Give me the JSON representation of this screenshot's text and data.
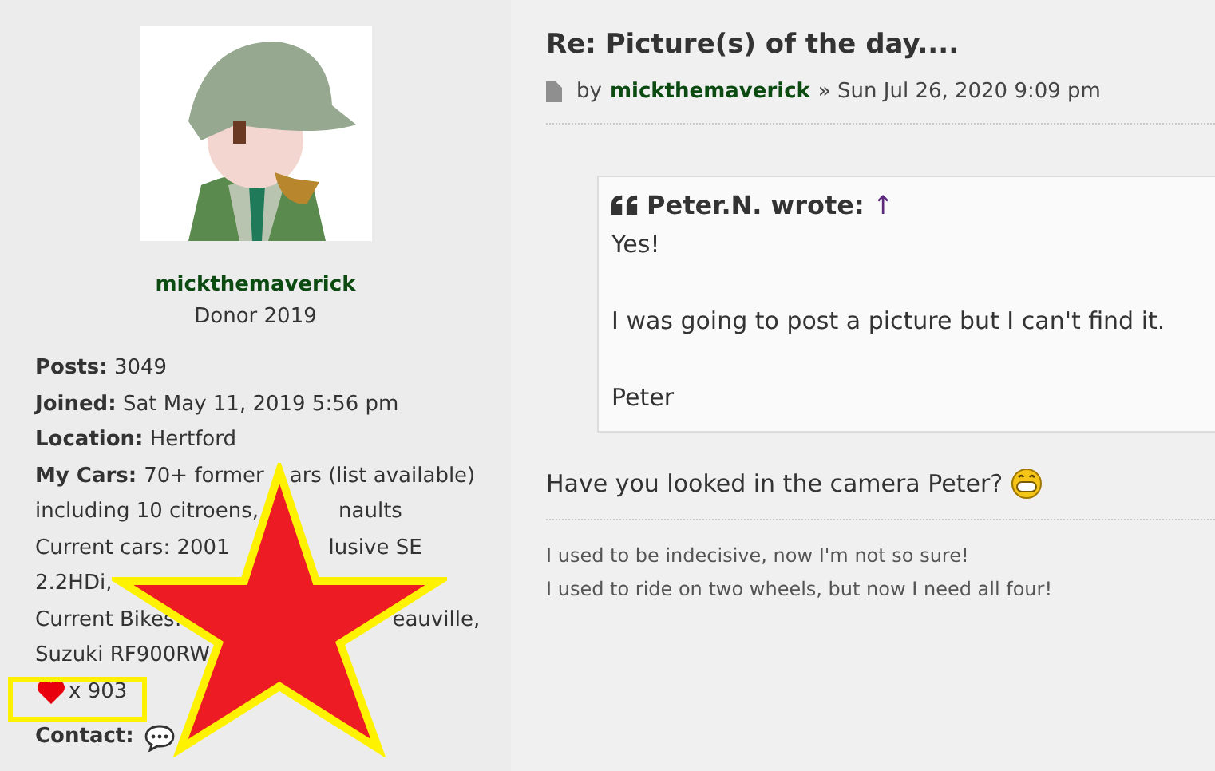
{
  "profile": {
    "username": "mickthemaverick",
    "rank": "Donor 2019",
    "lines": [
      {
        "kind": "field",
        "label": "Posts:",
        "value": "3049"
      },
      {
        "kind": "field",
        "label": "Joined:",
        "value": "Sat May 11, 2019 5:56 pm"
      },
      {
        "kind": "field",
        "label": "Location:",
        "value": "Hertford"
      },
      {
        "kind": "split",
        "label": "My Cars:",
        "left": "70+ former",
        "right": "ars (list available)"
      },
      {
        "kind": "split",
        "left": "including 10 citroens,",
        "right": "naults"
      },
      {
        "kind": "split",
        "left": "Current cars: 2001",
        "right": "lusive SE"
      },
      {
        "kind": "text",
        "value": "2.2HDi,"
      },
      {
        "kind": "split",
        "left": "Current Bikes:",
        "right": "eauville,"
      },
      {
        "kind": "text",
        "value": "Suzuki RF900RW"
      },
      {
        "kind": "likes",
        "value": "x 903"
      },
      {
        "kind": "contact",
        "label": "Contact:"
      }
    ]
  },
  "post": {
    "title": "Re: Picture(s) of the day....",
    "by": "by",
    "author": "mickthemaverick",
    "separator": "»",
    "date": "Sun Jul 26, 2020 9:09 pm",
    "quote": {
      "author": "Peter.N. wrote:",
      "link": "↑",
      "paragraphs": [
        "Yes!",
        "I was going to post a picture but I can't find it.",
        "Peter"
      ]
    },
    "body": "Have you looked in the camera Peter?",
    "signature": [
      "I used to be indecisive, now I'm not so sure!",
      "I used to ride on two wheels, but now I need all four!"
    ]
  }
}
